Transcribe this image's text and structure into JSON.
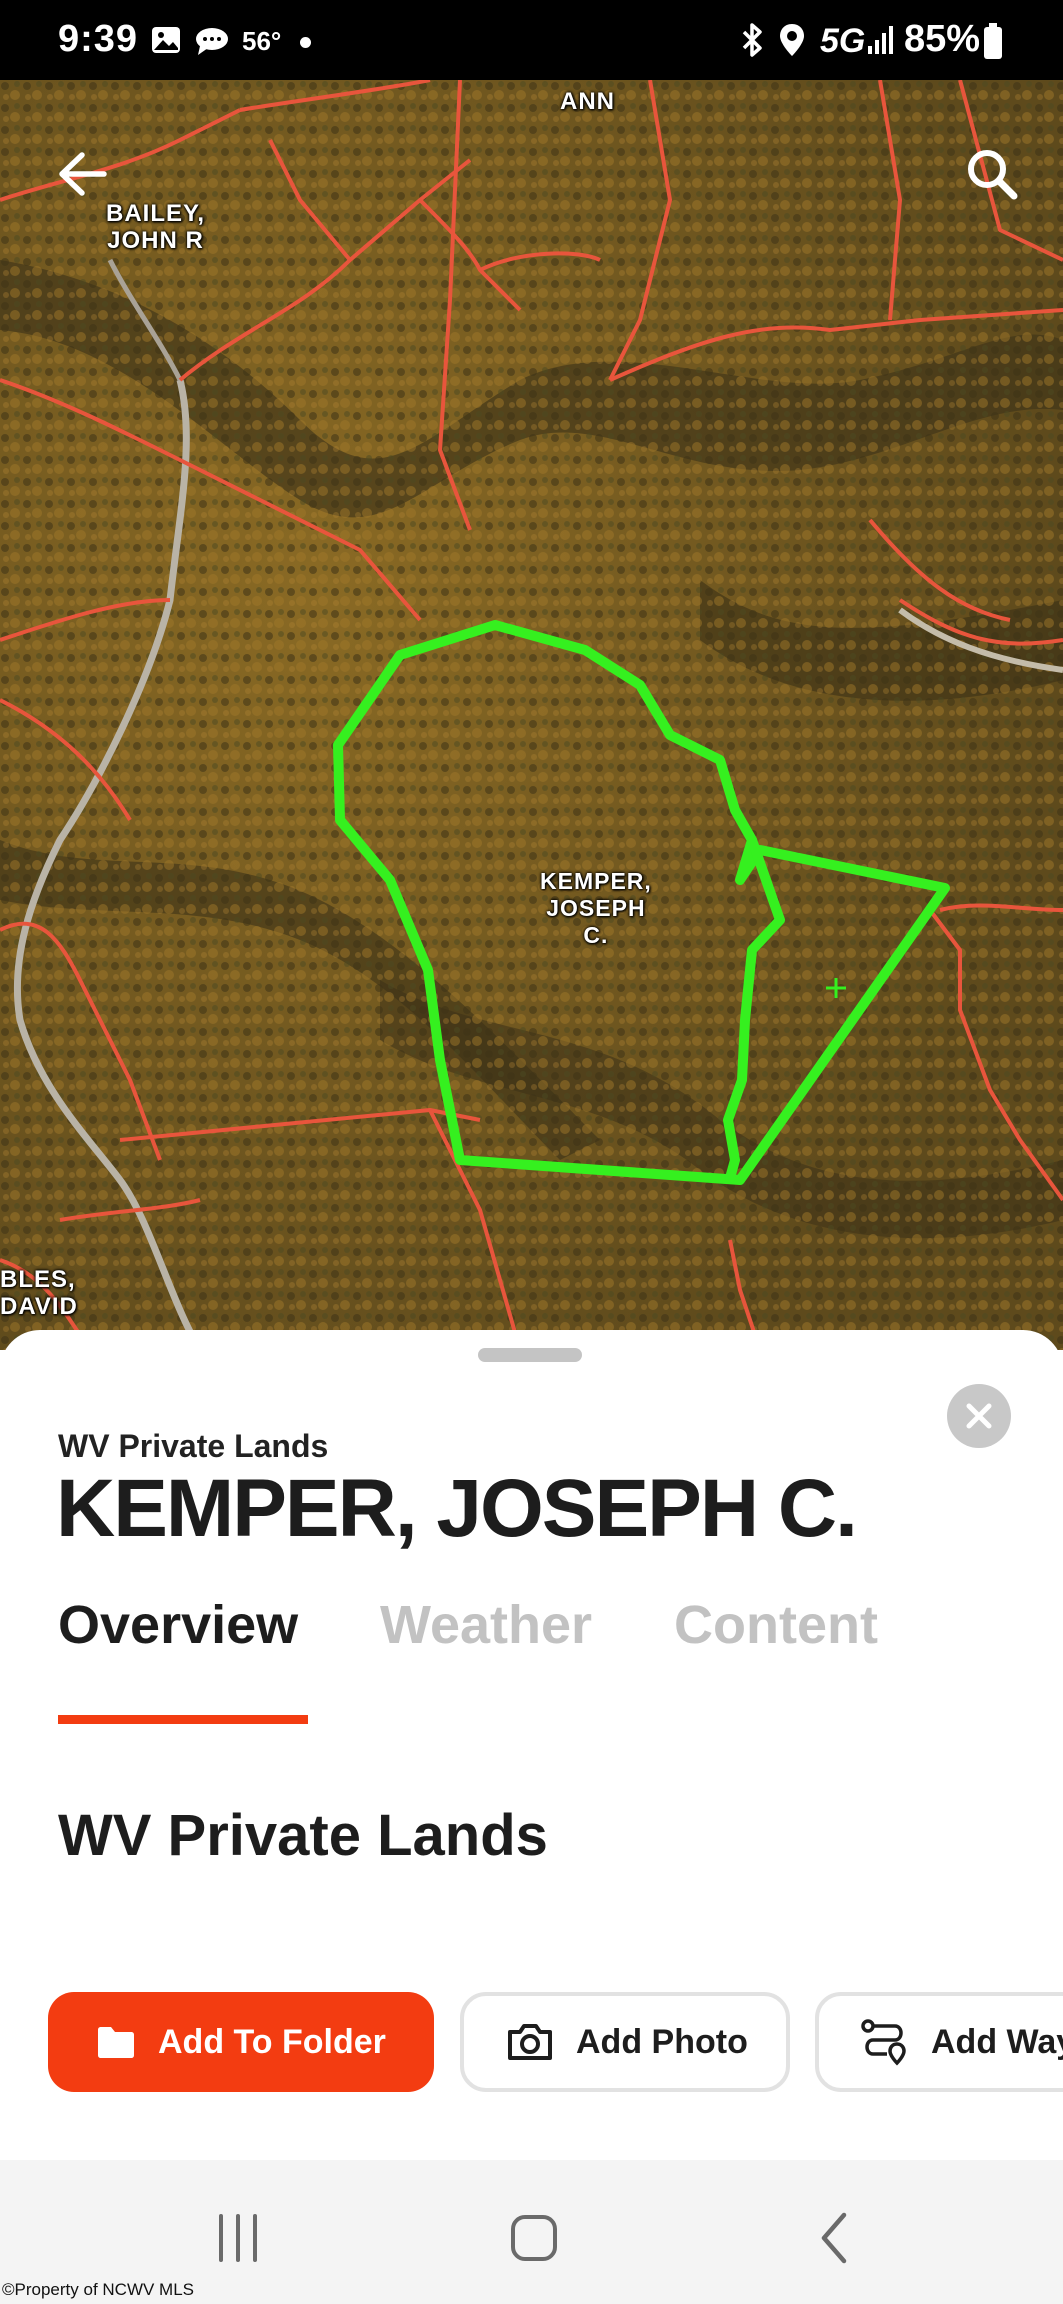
{
  "status_bar": {
    "time": "9:39",
    "temperature": "56°",
    "network": "5G",
    "battery": "85%"
  },
  "map": {
    "labels": {
      "ann": "ANN",
      "bailey": "BAILEY,\nJOHN R",
      "kemper": "KEMPER,\nJOSEPH\nC.",
      "bles": "BLES,\nDAVID"
    },
    "colors": {
      "parcel_outline": "#e8553c",
      "selected_parcel": "#35f01f"
    }
  },
  "sheet": {
    "subtitle": "WV Private Lands",
    "title": "KEMPER, JOSEPH C.",
    "tabs": [
      {
        "label": "Overview",
        "active": true
      },
      {
        "label": "Weather",
        "active": false
      },
      {
        "label": "Content",
        "active": false
      }
    ],
    "section_heading": "WV Private Lands",
    "actions": {
      "add_to_folder": "Add To Folder",
      "add_photo": "Add Photo",
      "add_waypoint": "Add Waypoint"
    },
    "accent_color": "#f33c11"
  },
  "watermark": "©Property of NCWV MLS"
}
